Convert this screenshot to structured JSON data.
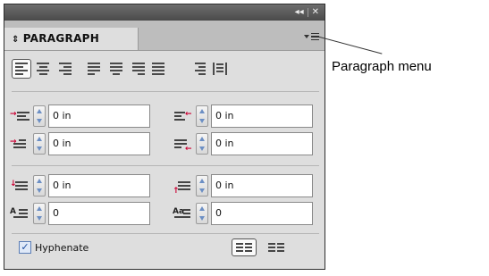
{
  "panel": {
    "controls": {
      "collapse": "◂◂",
      "close": "✕"
    },
    "tab": {
      "arrows": "⇕",
      "title": "PARAGRAPH"
    }
  },
  "alignment": {
    "buttons": [
      {
        "id": "align-left",
        "lines": [
          "full",
          "short",
          "full",
          "short"
        ],
        "active": true
      },
      {
        "id": "align-center",
        "lines": [
          "center-full",
          "center-short",
          "center-full",
          "center-short"
        ]
      },
      {
        "id": "align-right",
        "lines": [
          "right-full",
          "right-short",
          "right-full",
          "right-short"
        ]
      },
      {
        "id": "justify-left",
        "lines": [
          "full",
          "full",
          "full",
          "short"
        ]
      },
      {
        "id": "justify-center",
        "lines": [
          "full",
          "full",
          "full",
          "center-short"
        ]
      },
      {
        "id": "justify-right",
        "lines": [
          "full",
          "full",
          "full",
          "right-short"
        ]
      },
      {
        "id": "justify-all",
        "lines": [
          "full",
          "full",
          "full",
          "full"
        ]
      },
      {
        "id": "align-towards-spine",
        "lines": [
          "right-full",
          "right-short",
          "right-full",
          "right-short"
        ]
      },
      {
        "id": "align-away-from-spine",
        "lines": [
          "bar",
          "bar",
          "bar",
          "bar"
        ]
      }
    ]
  },
  "fields": {
    "left_indent": "0 in",
    "right_indent": "0 in",
    "first_line_indent": "0 in",
    "last_line_indent": "0 in",
    "space_before": "0 in",
    "space_after": "0 in",
    "drop_cap_lines": "0",
    "drop_cap_chars": "0"
  },
  "hyphenate": {
    "label": "Hyphenate",
    "checked": true,
    "check_glyph": "✓"
  },
  "callout": {
    "label": "Paragraph menu"
  }
}
